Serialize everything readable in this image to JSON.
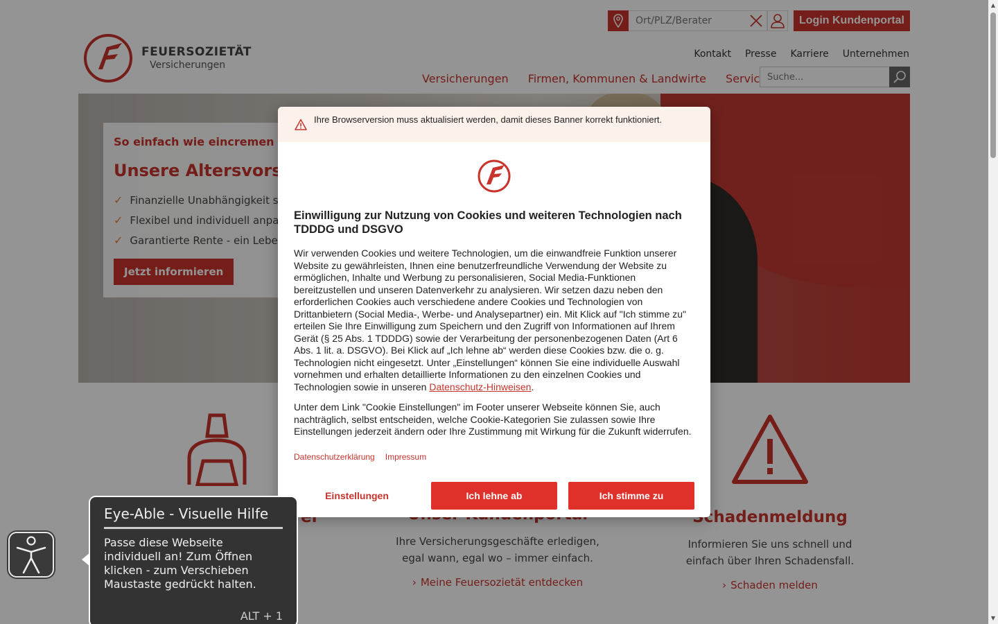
{
  "colors": {
    "brand_red": "#c8332c",
    "button_red": "#e0302a",
    "overlay": "rgba(0,0,0,0.42)"
  },
  "header": {
    "location_placeholder": "Ort/PLZ/Berater",
    "login_label": "Login Kundenportal",
    "logo_line1": "FEUERSOZIETÄT",
    "logo_line2": "Versicherungen",
    "meta_nav": [
      "Kontakt",
      "Presse",
      "Karriere",
      "Unternehmen"
    ],
    "main_nav": [
      "Versicherungen",
      "Firmen, Kommunen & Landwirte",
      "Service"
    ],
    "search_placeholder": "Suche..."
  },
  "hero": {
    "kicker": "So einfach wie eincremen",
    "title": "Unsere Altersvorso",
    "bullets": [
      "Finanzielle Unabhängigkeit si",
      "Flexibel und individuell anpas",
      "Garantierte Rente - ein Leben"
    ],
    "cta": "Jetzt informieren"
  },
  "features": [
    {
      "icon": "person-laptop-icon",
      "title": "er",
      "desc": "",
      "link": ""
    },
    {
      "icon": "portal-icon",
      "title": "Unser Kundenportal",
      "desc": "Ihre Versicherungsgeschäfte erledigen, egal wann, egal wo – immer einfach.",
      "link": "Meine Feuersozietät entdecken"
    },
    {
      "icon": "warning-triangle-icon",
      "title": "Schadenmeldung",
      "desc": "Informieren Sie uns schnell und einfach über Ihren Schadensfall.",
      "link": "Schaden melden"
    }
  ],
  "cookie_modal": {
    "warning": "Ihre Browserversion muss aktualisiert werden, damit dieses Banner korrekt funktioniert.",
    "title": "Einwilligung zur Nutzung von Cookies und weiteren Technologien nach TDDDG und DSGVO",
    "text": "Wir verwenden Cookies und weitere Technologien, um die einwandfreie Funktion unserer Website zu gewährleisten, Ihnen eine benutzerfreundliche Verwendung der Website zu ermöglichen, Inhalte und Werbung zu personalisieren, Social Media-Funktionen bereitzustellen und unseren Datenverkehr zu analysieren. Wir setzen dazu neben den erforderlichen Cookies auch verschiedene andere Cookies und Technologien von Drittanbietern (Social Media-, Werbe- und Analysepartner) ein. Mit Klick auf \"Ich stimme zu\" erteilen Sie Ihre Einwilligung zum Speichern und den Zugriff von Informationen auf Ihrem Gerät (§ 25 Abs. 1 TDDDG) sowie der Verarbeitung der personenbezogenen Daten (Art 6 Abs. 1 lit. a. DSGVO). Bei Klick auf „Ich lehne ab“ werden diese Cookies bzw. die o. g. Technologien nicht eingesetzt. Unter „Einstellungen“ können Sie eine individuelle Auswahl vornehmen und erhalten detaillierte Informationen zu den einzelnen Cookies und Technologien sowie in unseren ",
    "privacy_link": "Datenschutz-Hinweisen",
    "text_end": ".",
    "text2": "Unter dem Link \"Cookie Einstellungen\" im Footer unserer Webseite können Sie, auch nachträglich, selbst entscheiden, welche Cookie-Kategorien Sie zulassen sowie Ihre Einstellungen jederzeit ändern oder Ihre Zustimmung mit Wirkung für die Zukunft widerrufen.",
    "link_privacy": "Datenschutzerklärung",
    "link_imprint": "Impressum",
    "btn_settings": "Einstellungen",
    "btn_reject": "Ich lehne ab",
    "btn_accept": "Ich stimme zu"
  },
  "eye_able": {
    "title": "Eye-Able - Visuelle Hilfe",
    "desc": "Passe diese Webseite individuell an! Zum Öffnen klicken - zum Verschieben Maustaste gedrückt halten.",
    "shortcut": "ALT + 1"
  }
}
